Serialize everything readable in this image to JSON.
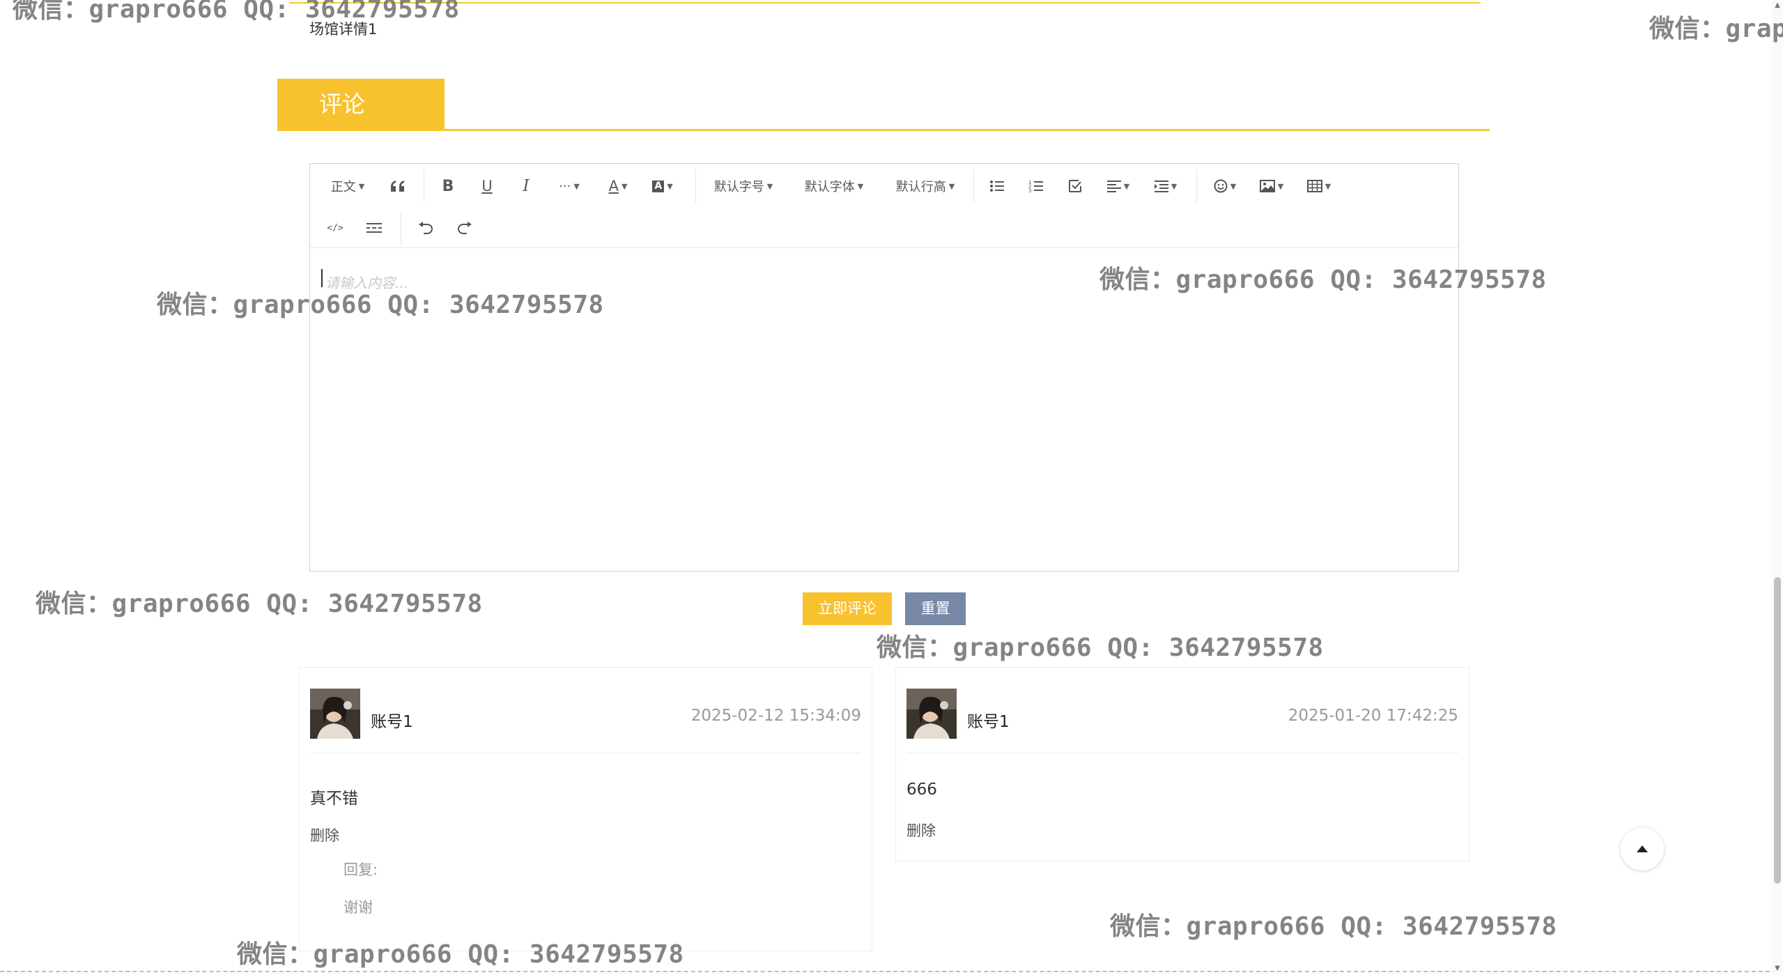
{
  "detail": {
    "text": "场馆详情1"
  },
  "comment_section": {
    "title": "评论"
  },
  "editor": {
    "toolbar": {
      "paragraph": "正文",
      "font_size": "默认字号",
      "font_family": "默认字体",
      "line_height": "默认行高",
      "more": "···"
    },
    "placeholder": "请输入内容..."
  },
  "actions": {
    "submit": "立即评论",
    "reset": "重置"
  },
  "comments": [
    {
      "user": "账号1",
      "time": "2025-02-12 15:34:09",
      "content": "真不错",
      "delete": "删除",
      "reply_label": "回复:",
      "reply_text": "谢谢"
    },
    {
      "user": "账号1",
      "time": "2025-01-20 17:42:25",
      "content": "666",
      "delete": "删除"
    }
  ],
  "watermark": {
    "text": "微信：grapro666 QQ: 3642795578",
    "partial": "微信：grap"
  },
  "colors": {
    "accent": "#f8c12e",
    "reset_button": "#7787a6"
  }
}
